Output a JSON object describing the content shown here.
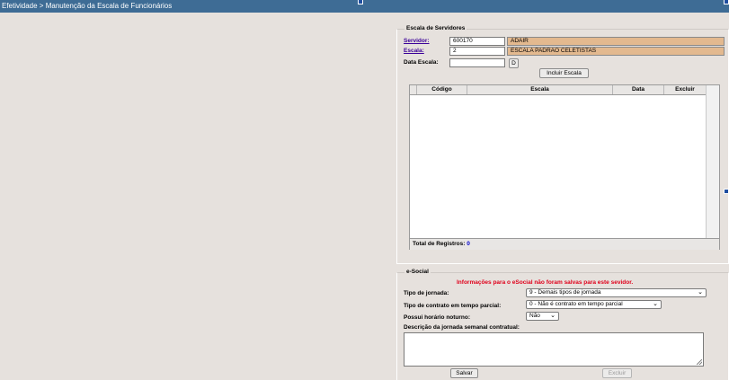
{
  "header": {
    "title": "Efetividade > Manutenção da Escala de Funcionários"
  },
  "escala": {
    "legend": "Escala de Servidores",
    "servidor_label": "Servidor:",
    "servidor_code": "600170",
    "servidor_name": "ADAIR",
    "escala_label": "Escala:",
    "escala_code": "2",
    "escala_name": "ESCALA PADRAO CELETISTAS",
    "data_label": "Data Escala:",
    "data_value": "",
    "date_button": "D",
    "include_button": "Incluir Escala",
    "columns": [
      "Código",
      "Escala",
      "Data",
      "Excluir"
    ],
    "rows": [],
    "total_label": "Total de Registros:",
    "total_value": "0"
  },
  "esocial": {
    "legend": "e-Social",
    "warning": "Informações para o eSocial não foram salvas para este sevidor.",
    "jornada_label": "Tipo de jornada:",
    "jornada_value": "9 - Demais tipos de jornada",
    "contrato_label": "Tipo de contrato em tempo parcial:",
    "contrato_value": "0 - Não é contrato em tempo parcial",
    "noturno_label": "Possui horário noturno:",
    "noturno_value": "Não",
    "descricao_label": "Descrição da jornada semanal contratual:",
    "descricao_value": "",
    "save_button": "Salvar",
    "delete_button": "Excluir"
  },
  "colors": {
    "titlebar": "#3e6c95",
    "readonly": "#e3b98f",
    "warning": "#e0001b",
    "link": "#3b0099"
  }
}
